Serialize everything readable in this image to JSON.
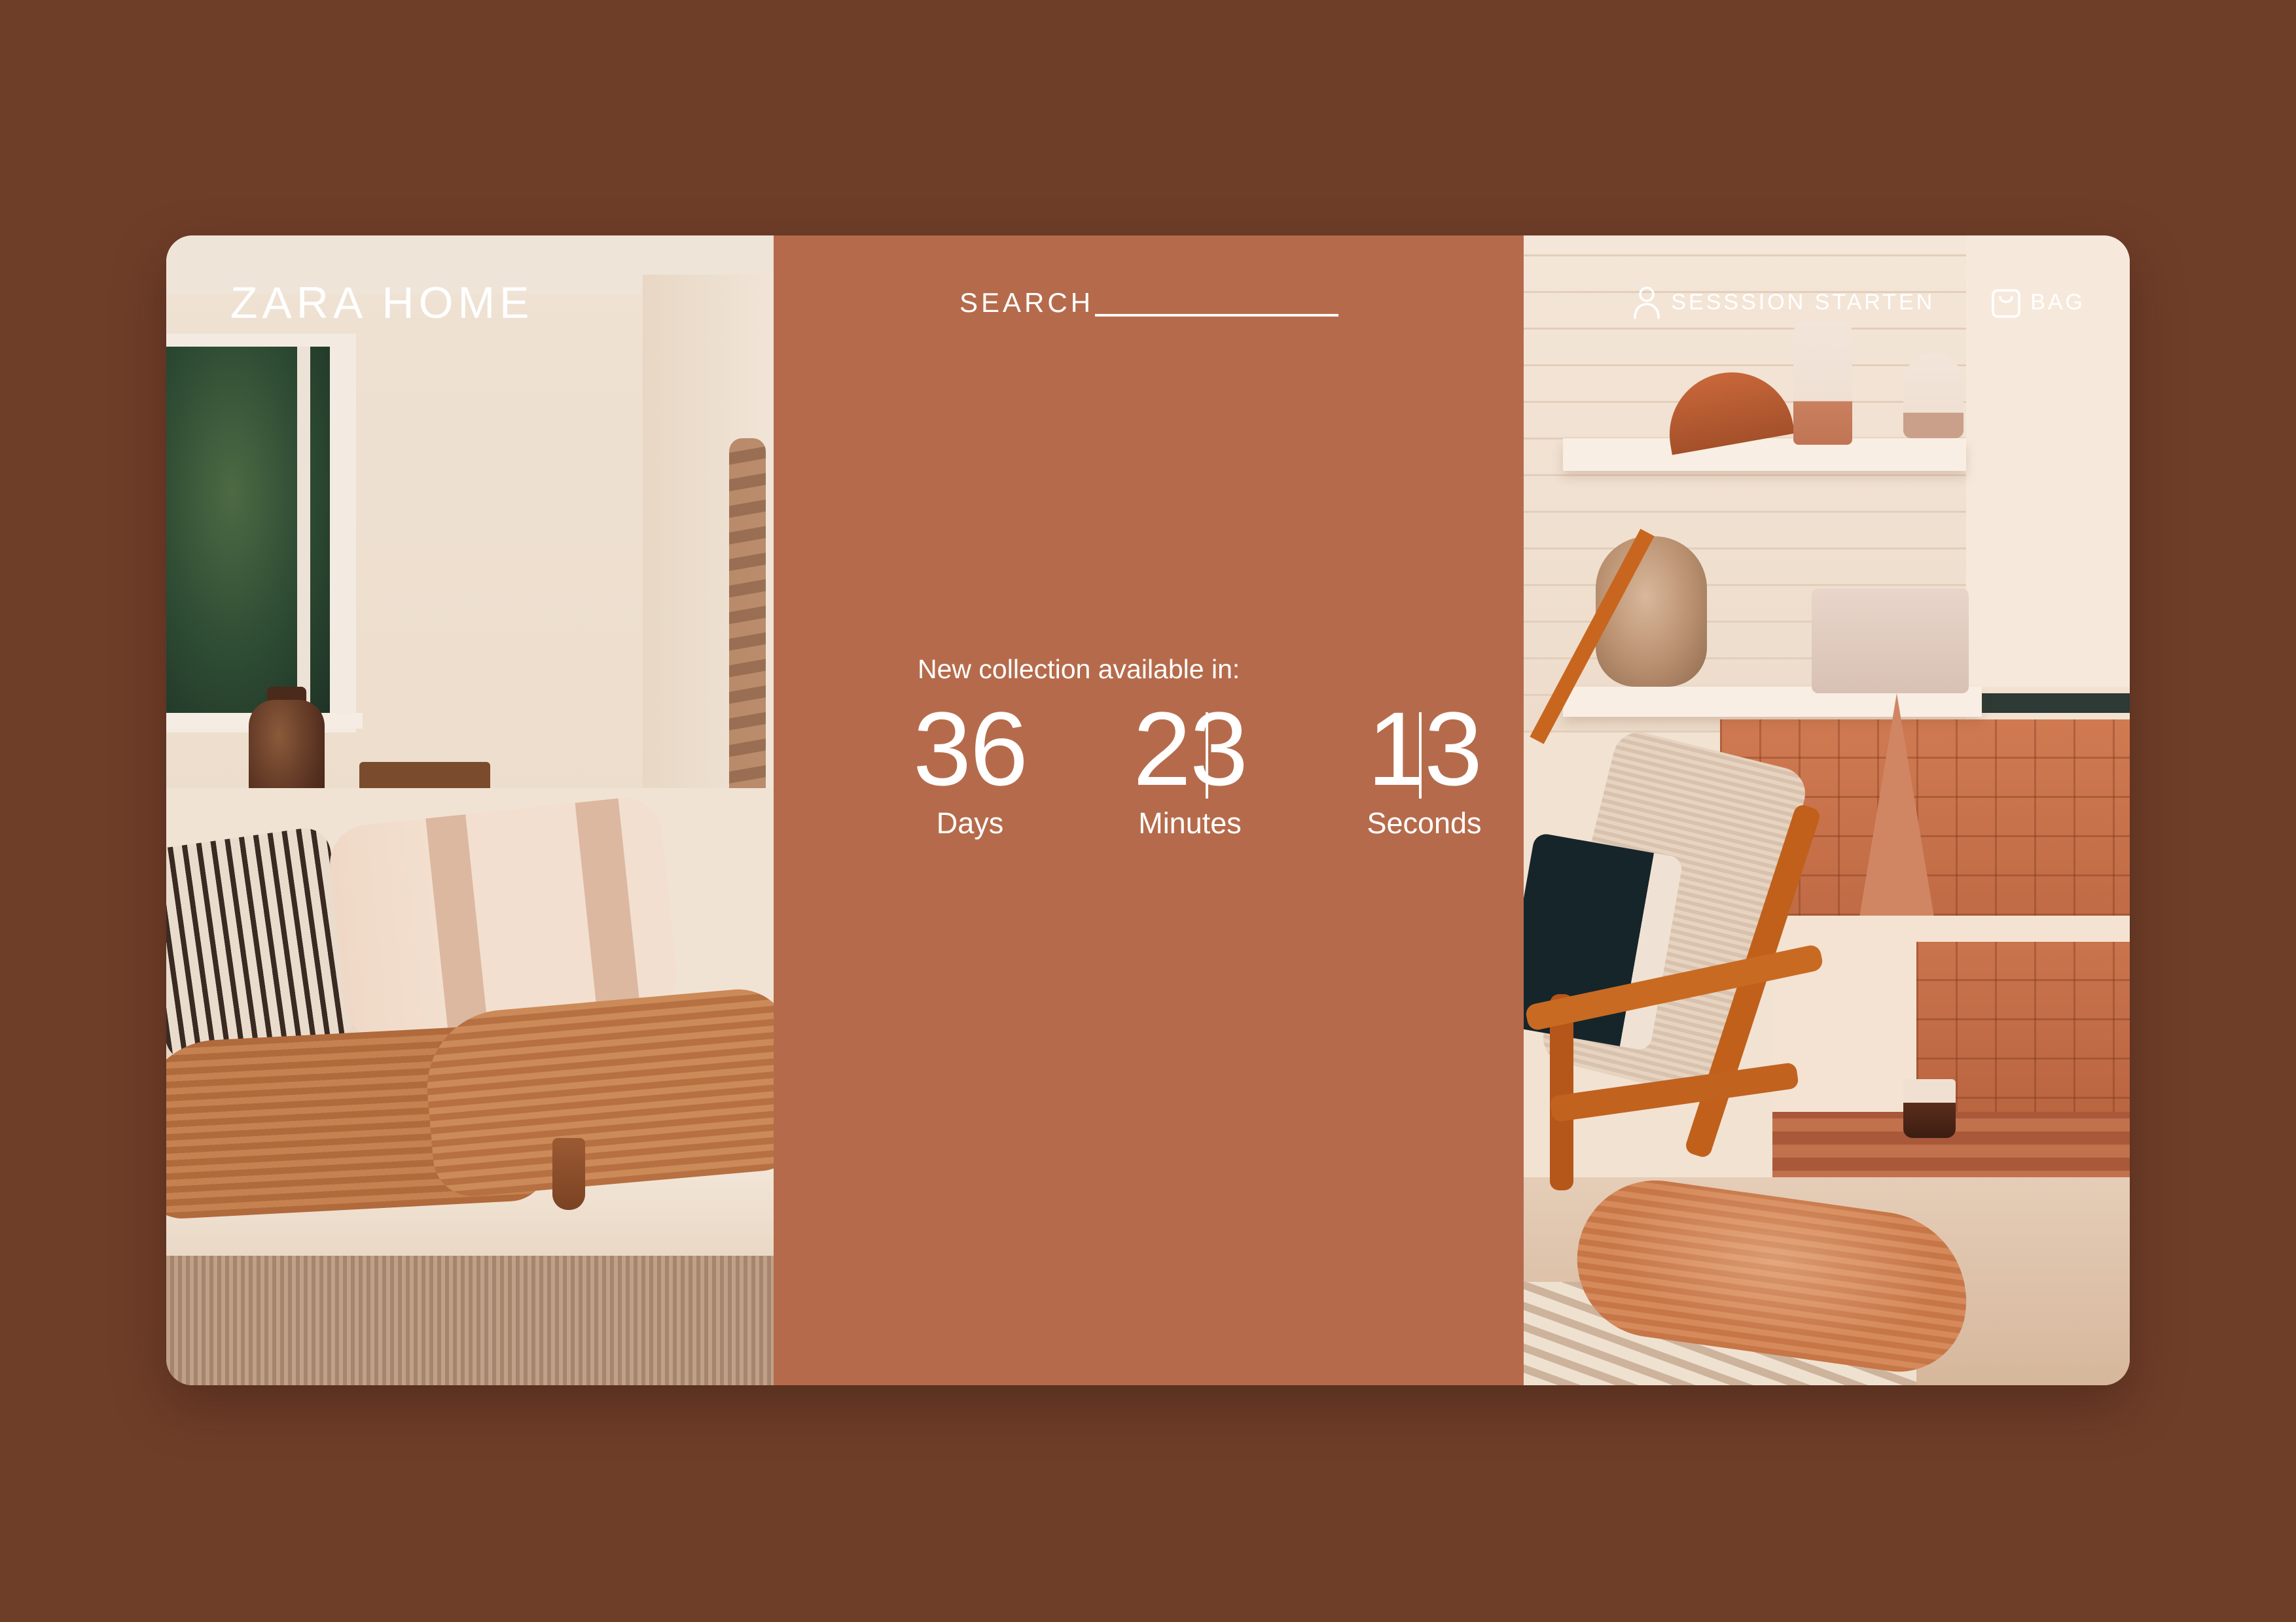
{
  "brand": {
    "logo_text": "ZARA HOME"
  },
  "header": {
    "search": {
      "label": "SEARCH",
      "value": "",
      "placeholder": ""
    },
    "session": {
      "label": "SESSSION STARTEN",
      "icon": "user-icon"
    },
    "bag": {
      "label": "BAG",
      "icon": "shopping-bag-icon"
    }
  },
  "countdown": {
    "headline": "New collection available in:",
    "units": [
      {
        "value": "36",
        "label": "Days"
      },
      {
        "value": "23",
        "label": "Minutes"
      },
      {
        "value": "13",
        "label": "Seconds"
      }
    ]
  },
  "colors": {
    "page_background": "#6f3e29",
    "center_panel": "#b56b4b",
    "text": "#ffffff"
  }
}
